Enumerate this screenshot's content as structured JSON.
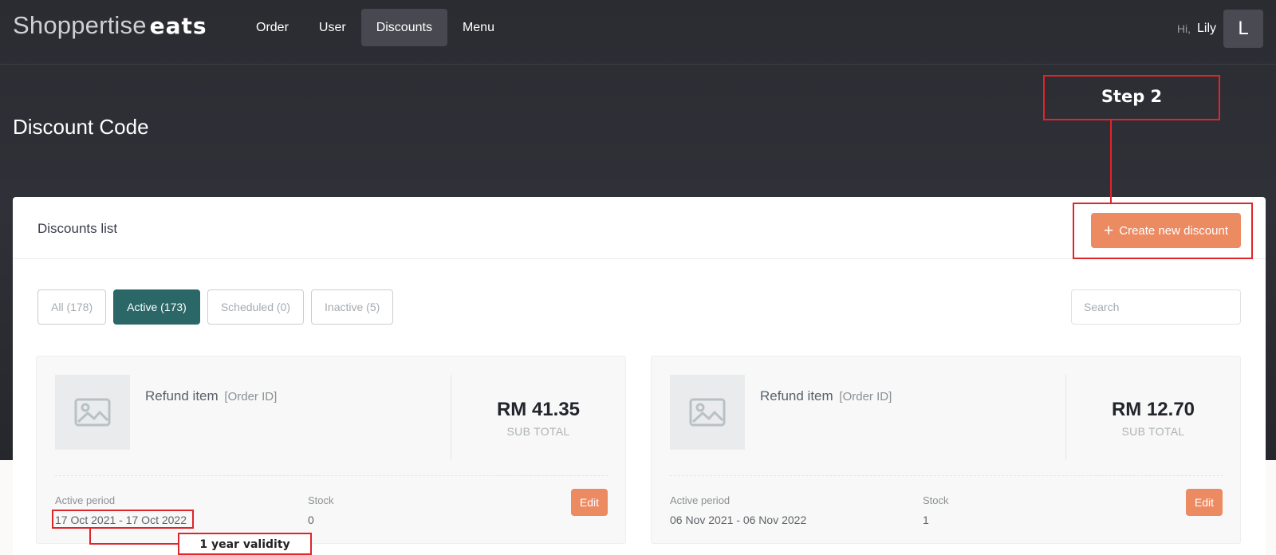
{
  "brand": {
    "light": "Shoppertise",
    "bold": "eats"
  },
  "nav": {
    "items": [
      {
        "label": "Order"
      },
      {
        "label": "User"
      },
      {
        "label": "Discounts"
      },
      {
        "label": "Menu"
      }
    ],
    "active": "Discounts"
  },
  "user": {
    "greeting": "Hi,",
    "name": "Lily",
    "initial": "L"
  },
  "page": {
    "title": "Discount Code"
  },
  "panel": {
    "title": "Discounts list",
    "create_button": {
      "icon": "plus-icon",
      "label": "Create new discount"
    }
  },
  "filters": [
    {
      "label": "All (178)"
    },
    {
      "label": "Active (173)"
    },
    {
      "label": "Scheduled (0)"
    },
    {
      "label": "Inactive (5)"
    }
  ],
  "active_filter": "Active (173)",
  "search": {
    "placeholder": "Search",
    "value": ""
  },
  "cards": [
    {
      "title": "Refund item",
      "subtitle": "[Order ID]",
      "image_icon": "image-placeholder-icon",
      "price": "RM 41.35",
      "price_label": "SUB TOTAL",
      "period_label": "Active period",
      "period": "17 Oct 2021 - 17 Oct 2022",
      "stock_label": "Stock",
      "stock": "0",
      "edit_label": "Edit"
    },
    {
      "title": "Refund item",
      "subtitle": "[Order ID]",
      "image_icon": "image-placeholder-icon",
      "price": "RM 12.70",
      "price_label": "SUB TOTAL",
      "period_label": "Active period",
      "period": "06 Nov 2021 - 06 Nov 2022",
      "stock_label": "Stock",
      "stock": "1",
      "edit_label": "Edit"
    }
  ],
  "annotations": {
    "step": "Step 2",
    "validity": "1 year validity",
    "color": "#e0252a"
  },
  "colors": {
    "accent": "#ec8a62",
    "active_filter": "#2b6767",
    "header_bg": "#2b2c32"
  }
}
